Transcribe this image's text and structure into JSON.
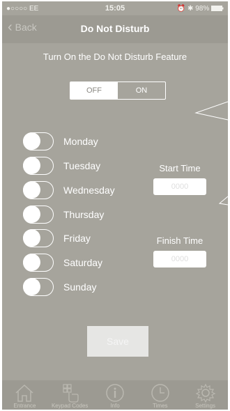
{
  "status_bar": {
    "carrier": "●○○○○ EE",
    "time": "15:05",
    "battery": "98%"
  },
  "nav": {
    "back_label": "Back",
    "title": "Do Not Disturb"
  },
  "instruction": "Turn On the Do Not Disturb Feature",
  "toggle_feature": {
    "off_label": "OFF",
    "on_label": "ON",
    "selected": "OFF"
  },
  "days": [
    {
      "label": "Monday",
      "enabled": false
    },
    {
      "label": "Tuesday",
      "enabled": false
    },
    {
      "label": "Wednesday",
      "enabled": false
    },
    {
      "label": "Thursday",
      "enabled": false
    },
    {
      "label": "Friday",
      "enabled": false
    },
    {
      "label": "Saturday",
      "enabled": false
    },
    {
      "label": "Sunday",
      "enabled": false
    }
  ],
  "start_time": {
    "label": "Start Time",
    "placeholder": "0000"
  },
  "finish_time": {
    "label": "Finish Time",
    "placeholder": "0000"
  },
  "save_label": "Save",
  "tabs": [
    {
      "label": "Entrance",
      "icon": "house-icon"
    },
    {
      "label": "Keypad Codes",
      "icon": "keypad-hand-icon"
    },
    {
      "label": "Info",
      "icon": "info-icon"
    },
    {
      "label": "Times",
      "icon": "clock-icon"
    },
    {
      "label": "Settings",
      "icon": "gear-icon"
    }
  ],
  "colors": {
    "background": "#a6a49c",
    "bars": "#9c9a92",
    "foreground": "#ffffff"
  }
}
